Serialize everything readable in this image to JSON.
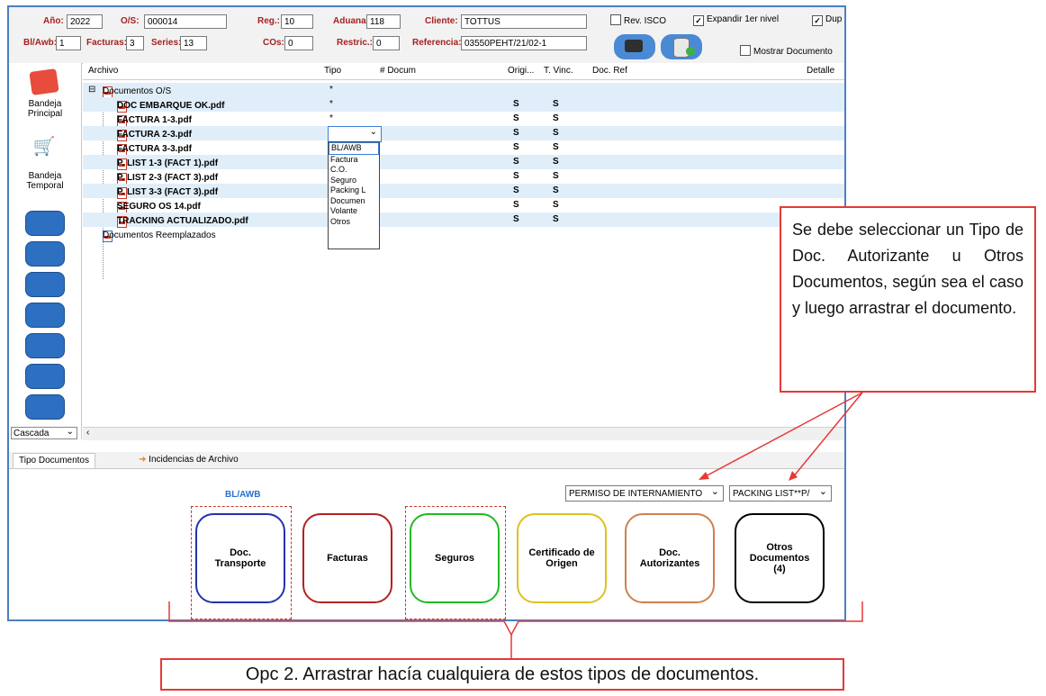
{
  "header": {
    "anio_label": "Año:",
    "anio": "2022",
    "os_label": "O/S:",
    "os": "000014",
    "reg_label": "Reg.:",
    "reg": "10",
    "aduana_label": "Aduana",
    "aduana": "118",
    "cliente_label": "Cliente:",
    "cliente": "TOTTUS",
    "blawb_label": "Bl/Awb:",
    "blawb": "1",
    "facturas_label": "Facturas:",
    "facturas": "3",
    "series_label": "Series:",
    "series": "13",
    "cos_label": "COs:",
    "cos": "0",
    "restric_label": "Restric.:",
    "restric": "0",
    "referencia_label": "Referencia:",
    "referencia": "03550PEHT/21/02-1",
    "rev_isco": "Rev. ISCO",
    "expandir": "Expandir 1er nivel",
    "dup": "Dup",
    "mostrar": "Mostrar Documento"
  },
  "sidebar": {
    "item1": "Bandeja Principal",
    "item2": "Bandeja Temporal",
    "cascada": "Cascada"
  },
  "grid": {
    "headers": [
      "Archivo",
      "Tipo",
      "# Docum",
      "Origi...",
      "T. Vinc.",
      "Doc. Ref",
      "Detalle"
    ],
    "root": "Documentos O/S",
    "root_tipo": "*",
    "files": [
      {
        "name": "DOC EMBARQUE OK.pdf",
        "tipo": "*",
        "orig": "S",
        "vinc": "S"
      },
      {
        "name": "FACTURA 1-3.pdf",
        "tipo": "*",
        "orig": "S",
        "vinc": "S"
      },
      {
        "name": "FACTURA 2-3.pdf",
        "tipo": "",
        "orig": "S",
        "vinc": "S"
      },
      {
        "name": "FACTURA 3-3.pdf",
        "tipo": "",
        "orig": "S",
        "vinc": "S"
      },
      {
        "name": "P. LIST 1-3 (FACT 1).pdf",
        "tipo": "",
        "orig": "S",
        "vinc": "S"
      },
      {
        "name": "P. LIST 2-3 (FACT 3).pdf",
        "tipo": "",
        "orig": "S",
        "vinc": "S"
      },
      {
        "name": "P. LIST 3-3 (FACT 3).pdf",
        "tipo": "",
        "orig": "S",
        "vinc": "S"
      },
      {
        "name": "SEGURO OS 14.pdf",
        "tipo": "",
        "orig": "S",
        "vinc": "S"
      },
      {
        "name": "TRACKING ACTUALIZADO.pdf",
        "tipo": "",
        "orig": "S",
        "vinc": "S"
      }
    ],
    "replaced": "Documentos Reemplazados",
    "replaced_tipo": "*"
  },
  "dropdown_options": [
    "BL/AWB",
    "Factura",
    "C.O.",
    "Seguro",
    "Packing L",
    "Documen",
    "Volante",
    "Otros"
  ],
  "tabs": [
    "Tipo Documentos",
    "Incidencias de Archivo"
  ],
  "panel": {
    "bl_awb_label": "BL/AWB",
    "combo1": "PERMISO DE INTERNAMIENTO",
    "combo2": "PACKING LIST**P/",
    "cards": [
      {
        "label": "Doc.\nTransporte",
        "color": "#2233aa"
      },
      {
        "label": "Facturas",
        "color": "#b22222"
      },
      {
        "label": "Seguros",
        "color": "#22bb22"
      },
      {
        "label": "Certificado de\nOrigen",
        "color": "#e0c020"
      },
      {
        "label": "Doc.\nAutorizantes",
        "color": "#d08050"
      },
      {
        "label": "Otros\nDocumentos\n(4)",
        "color": "#000000"
      }
    ]
  },
  "callout": "Se debe seleccionar un Tipo de Doc. Autorizante u Otros Documentos, según sea el caso y luego arrastrar el documento.",
  "bottom_note": "Opc 2. Arrastrar hacía cualquiera de estos tipos de documentos."
}
